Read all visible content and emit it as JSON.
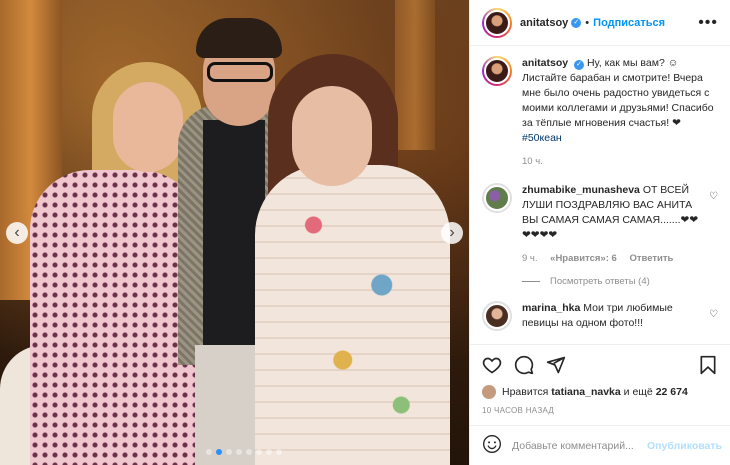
{
  "post": {
    "author": "anitatsoy",
    "follow_label": "Подписаться",
    "separator": "•",
    "more_icon": "more-horizontal-icon",
    "carousel": {
      "total": 8,
      "active": 2
    }
  },
  "caption": {
    "username": "anitatsoy",
    "text": "Ну, как мы вам? ☺ Листайте барабан и смотрите! Вчера мне было очень радостно увидеться с моими коллегами и друзьями! Спасибо за тёплые мгновения счастья! ❤ ",
    "hashtag": "#50кеан",
    "time": "10 ч."
  },
  "comments": [
    {
      "username": "zhumabike_munasheva",
      "text": "ОТ ВСЕЙ ЛУШИ ПОЗДРАВЛЯЮ ВАС АНИТА ВЫ САМАЯ САМАЯ САМАЯ.......❤❤❤❤❤❤",
      "time": "9 ч.",
      "likes": "«Нравится»: 6",
      "reply_label": "Ответить",
      "view_replies": "Посмотреть ответы (4)"
    },
    {
      "username": "marina_hka",
      "text": "Мои три любимые певицы на одном фото!!!"
    }
  ],
  "likes": {
    "prefix": "Нравится",
    "user": "tatiana_navka",
    "suffix": "и ещё",
    "count": "22 674"
  },
  "timestamp": "10 ЧАСОВ НАЗАД",
  "add_comment": {
    "placeholder": "Добавьте комментарий...",
    "publish_label": "Опубликовать"
  },
  "colors": {
    "accent": "#0095f6",
    "publish_disabled": "#b2dffc",
    "muted": "#8e8e8e",
    "text": "#262626"
  }
}
